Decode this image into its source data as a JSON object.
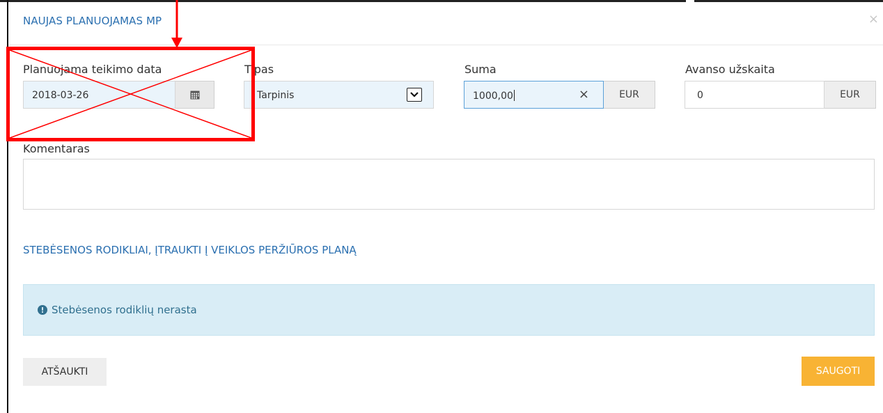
{
  "modal": {
    "title": "NAUJAS PLANUOJAMAS MP",
    "close_icon": "×"
  },
  "form": {
    "date": {
      "label": "Planuojama teikimo data",
      "value": "2018-03-26",
      "icon": "calendar-icon"
    },
    "type": {
      "label": "Tipas",
      "selected": "Tarpinis",
      "icon": "chevron-down-icon"
    },
    "sum": {
      "label": "Suma",
      "value": "1000,00",
      "clear": "×",
      "currency": "EUR"
    },
    "advance": {
      "label": "Avanso užskaita",
      "value": "0",
      "currency": "EUR"
    },
    "comment": {
      "label": "Komentaras",
      "value": ""
    }
  },
  "indicators": {
    "title": "STEBĖSENOS RODIKLIAI, ĮTRAUKTI Į VEIKLOS PERŽIŪROS PLANĄ",
    "empty_message": "Stebėsenos rodiklių nerasta",
    "info_icon": "exclamation-circle-icon"
  },
  "actions": {
    "cancel": "ATŠAUKTI",
    "save": "SAUGOTI"
  },
  "colors": {
    "accent_blue": "#2a6fb0",
    "save_orange": "#f8b334",
    "info_bg": "#d9edf6",
    "annotation_red": "#ff0000"
  }
}
